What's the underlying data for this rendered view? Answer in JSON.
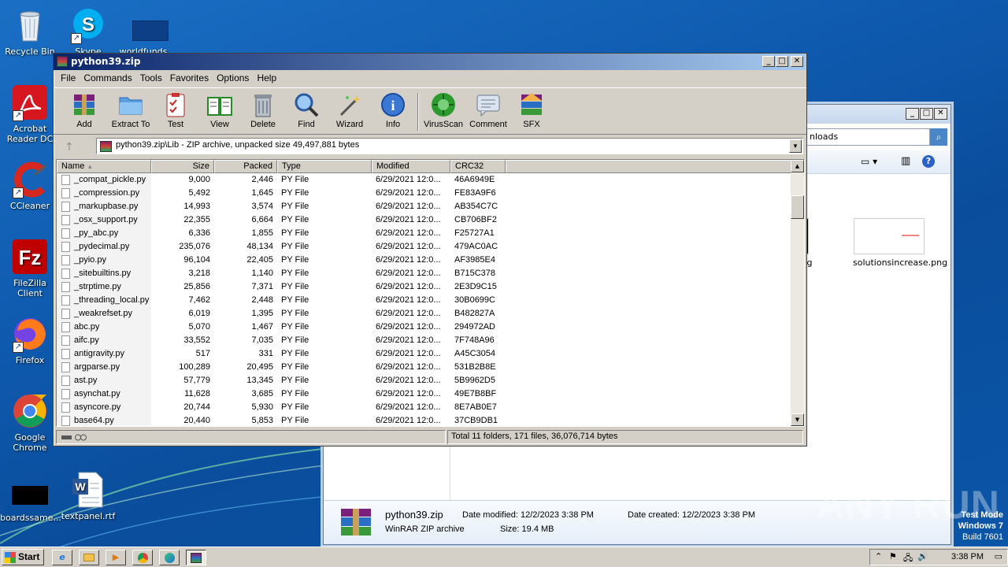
{
  "desktop": {
    "icons": [
      {
        "label": "Recycle Bin",
        "icon": "recycle-bin-icon"
      },
      {
        "label": "Skype",
        "icon": "skype-icon"
      },
      {
        "label": "worldfunds",
        "icon": "file-icon"
      },
      {
        "label": "Acrobat Reader DC",
        "icon": "acrobat-icon"
      },
      {
        "label": "CCleaner",
        "icon": "ccleaner-icon"
      },
      {
        "label": "FileZilla Client",
        "icon": "filezilla-icon"
      },
      {
        "label": "Firefox",
        "icon": "firefox-icon"
      },
      {
        "label": "Google Chrome",
        "icon": "chrome-icon"
      },
      {
        "label": "boardssame...",
        "icon": "file-icon"
      },
      {
        "label": "textpanel.rtf",
        "icon": "word-document-icon"
      }
    ]
  },
  "explorer": {
    "address": "nloads",
    "files": [
      {
        "label": "jpg"
      },
      {
        "label": "solutionsincrease.png"
      }
    ],
    "details": {
      "name": "python39.zip",
      "type": "WinRAR ZIP archive",
      "modified_label": "Date modified:",
      "modified": "12/2/2023 3:38 PM",
      "size_label": "Size:",
      "size": "19.4 MB",
      "created_label": "Date created:",
      "created": "12/2/2023 3:38 PM"
    }
  },
  "winrar": {
    "title": "python39.zip",
    "menu": [
      "File",
      "Commands",
      "Tools",
      "Favorites",
      "Options",
      "Help"
    ],
    "toolbar": [
      {
        "label": "Add",
        "icon": "add-archive-icon"
      },
      {
        "label": "Extract To",
        "icon": "extract-folder-icon"
      },
      {
        "label": "Test",
        "icon": "test-clipboard-icon"
      },
      {
        "label": "View",
        "icon": "view-book-icon"
      },
      {
        "label": "Delete",
        "icon": "trash-icon"
      },
      {
        "label": "Find",
        "icon": "magnifier-icon"
      },
      {
        "label": "Wizard",
        "icon": "wand-icon"
      },
      {
        "label": "Info",
        "icon": "info-icon"
      },
      {
        "label": "VirusScan",
        "icon": "virus-scan-icon"
      },
      {
        "label": "Comment",
        "icon": "comment-icon"
      },
      {
        "label": "SFX",
        "icon": "sfx-box-icon"
      }
    ],
    "path": "python39.zip\\Lib - ZIP archive, unpacked size 49,497,881 bytes",
    "columns": [
      "Name",
      "Size",
      "Packed",
      "Type",
      "Modified",
      "CRC32"
    ],
    "rows": [
      {
        "name": "_compat_pickle.py",
        "size": "9,000",
        "packed": "2,446",
        "type": "PY File",
        "modified": "6/29/2021 12:0...",
        "crc": "46A6949E"
      },
      {
        "name": "_compression.py",
        "size": "5,492",
        "packed": "1,645",
        "type": "PY File",
        "modified": "6/29/2021 12:0...",
        "crc": "FE83A9F6"
      },
      {
        "name": "_markupbase.py",
        "size": "14,993",
        "packed": "3,574",
        "type": "PY File",
        "modified": "6/29/2021 12:0...",
        "crc": "AB354C7C"
      },
      {
        "name": "_osx_support.py",
        "size": "22,355",
        "packed": "6,664",
        "type": "PY File",
        "modified": "6/29/2021 12:0...",
        "crc": "CB706BF2"
      },
      {
        "name": "_py_abc.py",
        "size": "6,336",
        "packed": "1,855",
        "type": "PY File",
        "modified": "6/29/2021 12:0...",
        "crc": "F25727A1"
      },
      {
        "name": "_pydecimal.py",
        "size": "235,076",
        "packed": "48,134",
        "type": "PY File",
        "modified": "6/29/2021 12:0...",
        "crc": "479AC0AC"
      },
      {
        "name": "_pyio.py",
        "size": "96,104",
        "packed": "22,405",
        "type": "PY File",
        "modified": "6/29/2021 12:0...",
        "crc": "AF3985E4"
      },
      {
        "name": "_sitebuiltins.py",
        "size": "3,218",
        "packed": "1,140",
        "type": "PY File",
        "modified": "6/29/2021 12:0...",
        "crc": "B715C378"
      },
      {
        "name": "_strptime.py",
        "size": "25,856",
        "packed": "7,371",
        "type": "PY File",
        "modified": "6/29/2021 12:0...",
        "crc": "2E3D9C15"
      },
      {
        "name": "_threading_local.py",
        "size": "7,462",
        "packed": "2,448",
        "type": "PY File",
        "modified": "6/29/2021 12:0...",
        "crc": "30B0699C"
      },
      {
        "name": "_weakrefset.py",
        "size": "6,019",
        "packed": "1,395",
        "type": "PY File",
        "modified": "6/29/2021 12:0...",
        "crc": "B482827A"
      },
      {
        "name": "abc.py",
        "size": "5,070",
        "packed": "1,467",
        "type": "PY File",
        "modified": "6/29/2021 12:0...",
        "crc": "294972AD"
      },
      {
        "name": "aifc.py",
        "size": "33,552",
        "packed": "7,035",
        "type": "PY File",
        "modified": "6/29/2021 12:0...",
        "crc": "7F748A96"
      },
      {
        "name": "antigravity.py",
        "size": "517",
        "packed": "331",
        "type": "PY File",
        "modified": "6/29/2021 12:0...",
        "crc": "A45C3054"
      },
      {
        "name": "argparse.py",
        "size": "100,289",
        "packed": "20,495",
        "type": "PY File",
        "modified": "6/29/2021 12:0...",
        "crc": "531B2B8E"
      },
      {
        "name": "ast.py",
        "size": "57,779",
        "packed": "13,345",
        "type": "PY File",
        "modified": "6/29/2021 12:0...",
        "crc": "5B9962D5"
      },
      {
        "name": "asynchat.py",
        "size": "11,628",
        "packed": "3,685",
        "type": "PY File",
        "modified": "6/29/2021 12:0...",
        "crc": "49E7B8BF"
      },
      {
        "name": "asyncore.py",
        "size": "20,744",
        "packed": "5,930",
        "type": "PY File",
        "modified": "6/29/2021 12:0...",
        "crc": "8E7AB0E7"
      },
      {
        "name": "base64.py",
        "size": "20,440",
        "packed": "5,853",
        "type": "PY File",
        "modified": "6/29/2021 12:0...",
        "crc": "37CB9DB1"
      }
    ],
    "status": "Total 11 folders, 171 files, 36,076,714 bytes"
  },
  "taskbar": {
    "start": "Start",
    "clock": "3:38 PM"
  },
  "os_notice": {
    "line1": "Test Mode",
    "line2": "Windows 7",
    "line3": "Build 7601"
  },
  "watermark": "ANY RUN"
}
